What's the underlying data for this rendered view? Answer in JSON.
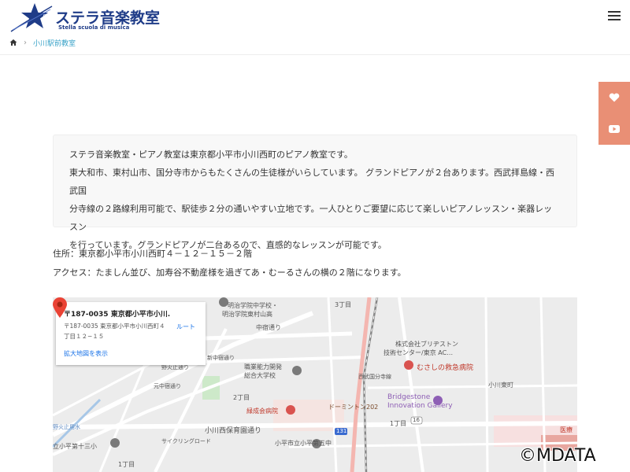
{
  "brand": {
    "title": "ステラ音楽教室",
    "subtitle": "Stella scuola di musica",
    "star_text": "Stella",
    "accent": "#1f3c88"
  },
  "breadcrumb": {
    "current": "小川駅前教室",
    "color": "#3aa3c8"
  },
  "side_tabs": {
    "color": "#e98f75",
    "icons": [
      "heart-icon",
      "youtube-icon"
    ]
  },
  "intro": {
    "line1": "ステラ音楽教室・ピアノ教室は東京都小平市小川西町のピアノ教室です。",
    "line2": "東大和市、東村山市、国分寺市からもたくさんの生徒様がいらしています。 グランドピアノが２台あります。西武拝島線・西武国",
    "line3": "分寺線の２路線利用可能で、駅徒歩２分の通いやすい立地です。一人ひとりご要望に応じて楽しいピアノレッスン・楽器レッスン",
    "line4": "を行っています。グランドピアノが二台あるので、直感的なレッスンが可能です。"
  },
  "address": {
    "line1": "住所：東京都小平市小川西町４－１２－１５－２階",
    "line2": "アクセス：たましん並び、加寿谷不動産様を過ぎてあ・むーるさんの横の２階になります。"
  },
  "map": {
    "card": {
      "title": "〒187-0035 東京都小平市小川...",
      "addr1": "〒187-0035 東京都小平市小川西町４",
      "addr2": "丁目１２−１５",
      "enlarge": "拡大地図を表示",
      "route": "ルート"
    },
    "labels": {
      "school1": "明治学院中学校・",
      "school2": "明治学院東村山高",
      "chome3": "3丁目",
      "nakajuku": "中宿通り",
      "bridgestone1": "株式会社ブリヂストン",
      "bridgestone2": "技術センター/東京 AC…",
      "shinchuku": "新中宿通り",
      "college1": "職業能力開発",
      "college2": "総合大学校",
      "musashi": "むさしの救急病院",
      "ogawahigashi": "小川東町",
      "nobidome": "野火止通り",
      "motonaka": "元中宿通り",
      "chome2": "2丁目",
      "ryokusei": "緑成会病院",
      "dormy": "ドーミントン202",
      "bs_gallery1": "Bridgestone",
      "bs_gallery2": "Innovation Gallery",
      "nobidome_yosui": "野火止用水",
      "hoiku": "小川西保育園通り",
      "seibu": "西武国分寺線",
      "chome1a": "1丁目",
      "route16": "16",
      "route131": "131",
      "iryo": "医療",
      "elementary13": "立小平第十三小",
      "kodaira5": "小平市立小平第五中",
      "chome1b": "1丁目",
      "cycling": "サイクリングロード"
    }
  },
  "watermark": "©MDATA"
}
